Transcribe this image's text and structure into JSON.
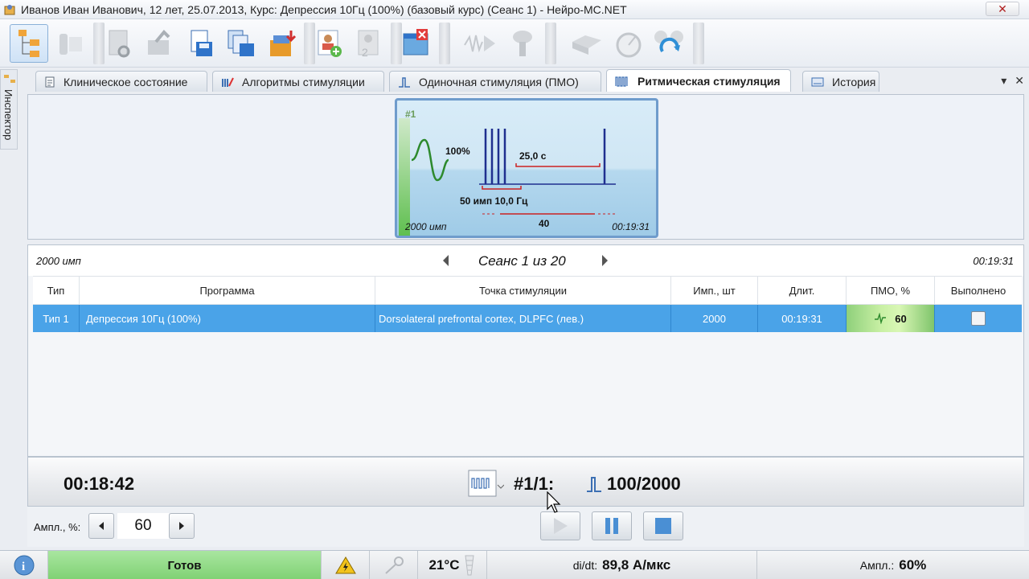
{
  "window": {
    "title": "Иванов Иван Иванович, 12 лет, 25.07.2013, Курс: Депрессия 10Гц (100%) (базовый курс) (Сеанс 1) - Нейро-МС.NET",
    "close_label": "✕"
  },
  "sidebar": {
    "label": "Инспектор"
  },
  "tabs": [
    {
      "label": "Клиническое состояние",
      "icon": "document-icon"
    },
    {
      "label": "Алгоритмы стимуляции",
      "icon": "algorithm-icon"
    },
    {
      "label": "Одиночная стимуляция (ПМО)",
      "icon": "single-pulse-icon"
    },
    {
      "label": "Ритмическая стимуляция",
      "icon": "rhythmic-pulse-icon",
      "active": true
    },
    {
      "label": "История",
      "icon": "history-icon"
    }
  ],
  "protocol_card": {
    "index": "#1",
    "amplitude": "100%",
    "interval": "25,0 с",
    "train": "50 имп 10,0 Гц",
    "repeats": "40",
    "total_pulses": "2000 имп",
    "duration": "00:19:31"
  },
  "session": {
    "pulses": "2000 имп",
    "title": "Сеанс 1 из 20",
    "duration": "00:19:31",
    "columns": [
      "Тип",
      "Программа",
      "Точка стимуляции",
      "Имп., шт",
      "Длит.",
      "ПМО, %",
      "Выполнено"
    ],
    "row": {
      "type": "Тип 1",
      "program": "Депрессия 10Гц (100%)",
      "point": "Dorsolateral prefrontal cortex, DLPFC (лев.)",
      "pulses": "2000",
      "duration": "00:19:31",
      "pmo": "60"
    }
  },
  "progress": {
    "elapsed": "00:18:42",
    "protocol": "#1/1:",
    "counter": "100/2000"
  },
  "controls": {
    "amp_label": "Ампл., %:",
    "amp_value": "60"
  },
  "status": {
    "state": "Готов",
    "temperature": "21°C",
    "didt_label": "di/dt:",
    "didt_value": "89,8 А/мкс",
    "amp_label": "Ампл.:",
    "amp_value": "60%"
  },
  "colors": {
    "selected_row": "#4aa3e8",
    "ready": "#7fd173",
    "accent": "#1f3b8f"
  }
}
